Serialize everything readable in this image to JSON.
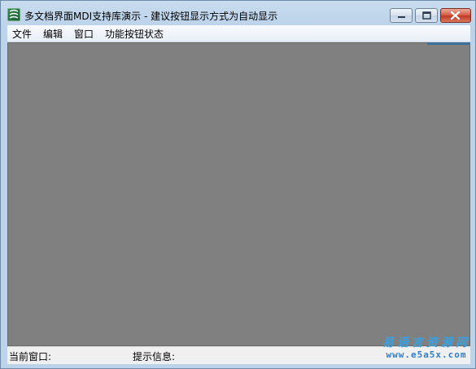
{
  "window": {
    "title": "多文档界面MDI支持库演示 - 建议按钮显示方式为自动显示"
  },
  "caption_buttons": {
    "minimize_icon": "minimize-icon",
    "maximize_icon": "maximize-icon",
    "close_icon": "close-icon"
  },
  "menu": {
    "items": [
      {
        "label": "文件"
      },
      {
        "label": "编辑"
      },
      {
        "label": "窗口"
      },
      {
        "label": "功能按钮状态"
      }
    ]
  },
  "mdi_client": {
    "background_color": "#808080"
  },
  "statusbar": {
    "current_window_label": "当前窗口:",
    "hint_label": "提示信息:"
  },
  "watermark": {
    "text": "易语言资源网",
    "url": "www.e5a5x.com"
  }
}
